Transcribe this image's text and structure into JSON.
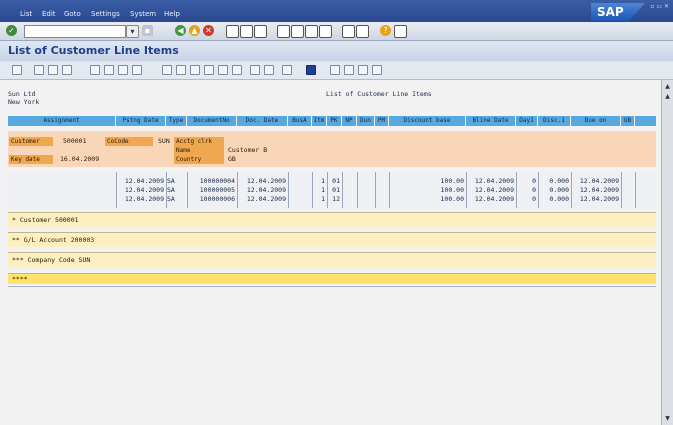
{
  "menu": {
    "items": [
      "List",
      "Edit",
      "Goto",
      "Settings",
      "System",
      "Help"
    ],
    "logo": "SAP"
  },
  "title": "List of Customer Line Items",
  "report": {
    "company": "Sun Ltd",
    "city": "New York",
    "heading": "List of Customer Line Items",
    "columns": [
      "Assignment",
      "Pstng Date",
      "Type",
      "DocumentNo",
      "Doc. Date",
      "BusA",
      "Itm",
      "PK",
      "NP",
      "Dun",
      "PM",
      "Discount base",
      "Bline Date",
      "Day1",
      "Disc.1",
      "Due on",
      "GB"
    ],
    "customer": {
      "customer_label": "Customer",
      "customer_value": "500001",
      "cocode_label": "CoCode",
      "cocode_value": "SUN",
      "acctg_clerk": "Acctg clrk",
      "name_label": "Name",
      "name_value": "Customer B",
      "keydate_label": "Key date",
      "keydate_value": "16.04.2009",
      "country_label": "Country",
      "country_value": "GB"
    },
    "rows": [
      {
        "pstng": "12.04.2009",
        "type": "SA",
        "doc": "100000004",
        "docdate": "12.04.2009",
        "itm": "1",
        "pk": "01",
        "disc": "100.00",
        "bline": "12.04.2009",
        "day1": "0",
        "disc1": "0.000",
        "due": "12.04.2009"
      },
      {
        "pstng": "12.04.2009",
        "type": "SA",
        "doc": "100000005",
        "docdate": "12.04.2009",
        "itm": "1",
        "pk": "01",
        "disc": "100.00",
        "bline": "12.04.2009",
        "day1": "0",
        "disc1": "0.000",
        "due": "12.04.2009"
      },
      {
        "pstng": "12.04.2009",
        "type": "SA",
        "doc": "100000006",
        "docdate": "12.04.2009",
        "itm": "1",
        "pk": "12",
        "disc": "100.00",
        "bline": "12.04.2009",
        "day1": "0",
        "disc1": "0.000",
        "due": "12.04.2009"
      }
    ],
    "totals": [
      "*   Customer 500001",
      "**  G/L Account 200003",
      "*** Company Code SUN",
      "****"
    ]
  }
}
